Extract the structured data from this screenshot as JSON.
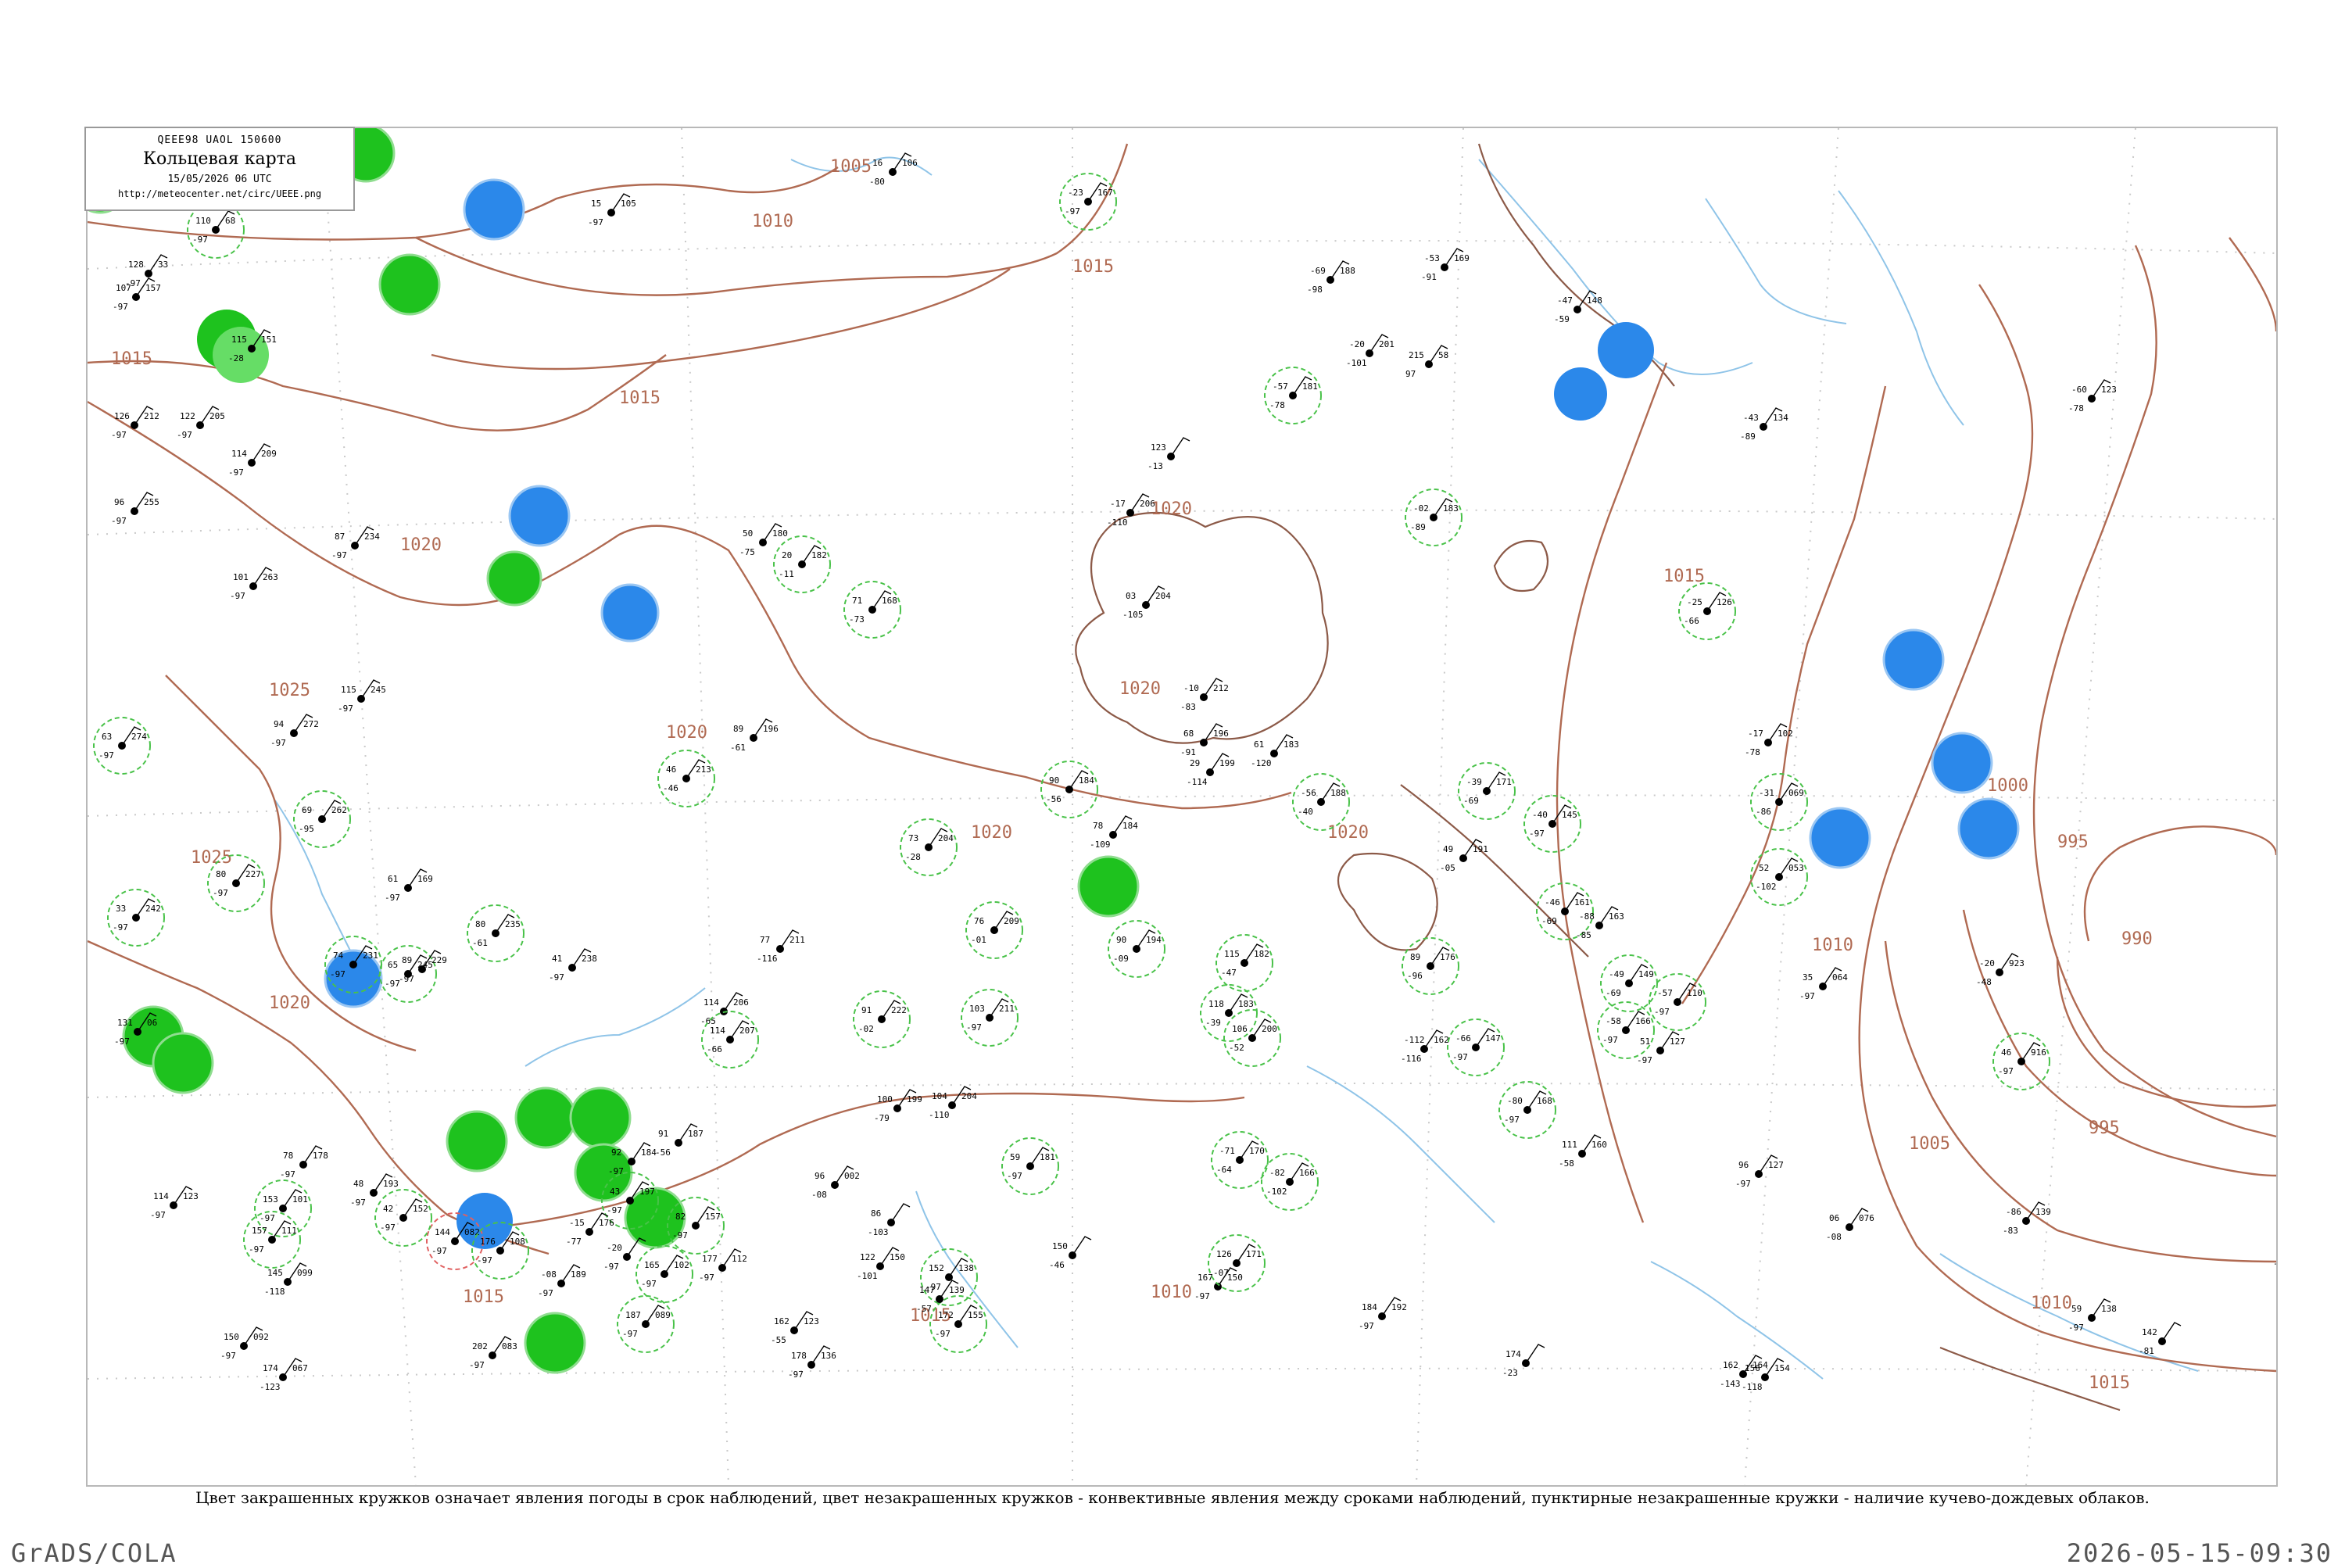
{
  "legend": {
    "header": "QEEE98  UAOL  150600",
    "title": "Кольцевая карта",
    "datetime": "15/05/2026 06 UTC",
    "url": "http://meteocenter.net/circ/UEEE.png"
  },
  "caption": "Цвет закрашенных кружков означает явления погоды в срок наблюдений, цвет незакрашенных кружков - конвективные явления между сроками наблюдений, пунктирные незакрашенные кружки - наличие кучево-дождевых облаков.",
  "footer": {
    "left": "GrADS/COLA",
    "right": "2026-05-15-09:30"
  },
  "isobar_labels": [
    "1005",
    "1010",
    "1015",
    "1015",
    "1015",
    "1020",
    "1020",
    "1020",
    "1020",
    "1020",
    "1020",
    "1025",
    "1025",
    "1020",
    "1015",
    "1015",
    "1010",
    "1005",
    "1000",
    "995",
    "990",
    "995",
    "1010",
    "1015",
    "1010",
    "1015"
  ],
  "colors": {
    "isobar": "#b06a52",
    "coastline": "#8c5a48",
    "river": "#8fc4e8",
    "precip_fill": "#1ec21e",
    "precip_fill_light": "#66dd66",
    "fog_fill": "#2b88ea",
    "cb_ring": "#49c249",
    "thunder_ring": "#e06060"
  },
  "stations": [
    {
      "t": "110",
      "d": "-97",
      "p": "68",
      "marker": "cb"
    },
    {
      "t": "128",
      "d": "-97",
      "p": "33",
      "marker": "none"
    },
    {
      "t": "107",
      "d": "-97",
      "p": "157",
      "marker": "none"
    },
    {
      "t": "115",
      "d": "-28",
      "p": "151",
      "marker": "none"
    },
    {
      "t": "126",
      "d": "-97",
      "p": "212",
      "marker": "none"
    },
    {
      "t": "122",
      "d": "-97",
      "p": "205",
      "marker": "none"
    },
    {
      "t": "114",
      "d": "-97",
      "p": "209",
      "marker": "none"
    },
    {
      "t": "96",
      "d": "-97",
      "p": "255",
      "marker": "none"
    },
    {
      "t": "87",
      "d": "-97",
      "p": "234",
      "marker": "none"
    },
    {
      "t": "101",
      "d": "-97",
      "p": "263",
      "marker": "none"
    },
    {
      "t": "63",
      "d": "-97",
      "p": "274",
      "marker": "cb"
    },
    {
      "t": "115",
      "d": "-97",
      "p": "245",
      "marker": "none"
    },
    {
      "t": "94",
      "d": "-97",
      "p": "272",
      "marker": "none"
    },
    {
      "t": "80",
      "d": "-97",
      "p": "227",
      "marker": "cb"
    },
    {
      "t": "33",
      "d": "-97",
      "p": "242",
      "marker": "cb"
    },
    {
      "t": "131",
      "d": "-97",
      "p": "06",
      "marker": "none"
    },
    {
      "t": "114",
      "d": "-97",
      "p": "123",
      "marker": "none"
    },
    {
      "t": "153",
      "d": "-97",
      "p": "101",
      "marker": "cb"
    },
    {
      "t": "157",
      "d": "-97",
      "p": "111",
      "marker": "cb"
    },
    {
      "t": "145",
      "d": "-118",
      "p": "099",
      "marker": "none"
    },
    {
      "t": "150",
      "d": "-97",
      "p": "092",
      "marker": "none"
    },
    {
      "t": "174",
      "d": "-123",
      "p": "067",
      "marker": "none"
    },
    {
      "t": "144",
      "d": "-97",
      "p": "082",
      "marker": "thunder"
    },
    {
      "t": "202",
      "d": "-97",
      "p": "083",
      "marker": "none"
    },
    {
      "t": "187",
      "d": "-97",
      "p": "089",
      "marker": "cb"
    },
    {
      "t": "165",
      "d": "-97",
      "p": "102",
      "marker": "cb"
    },
    {
      "t": "177",
      "d": "-97",
      "p": "112",
      "marker": "none"
    },
    {
      "t": "162",
      "d": "-55",
      "p": "123",
      "marker": "none"
    },
    {
      "t": "178",
      "d": "-97",
      "p": "136",
      "marker": "none"
    },
    {
      "t": "152",
      "d": "-97",
      "p": "138",
      "marker": "cb"
    },
    {
      "t": "172",
      "d": "-97",
      "p": "155",
      "marker": "cb"
    },
    {
      "t": "167",
      "d": "-97",
      "p": "150",
      "marker": "none"
    },
    {
      "t": "184",
      "d": "-97",
      "p": "192",
      "marker": "none"
    },
    {
      "t": "174",
      "d": "-23",
      "p": "",
      "marker": "none"
    },
    {
      "t": "162",
      "d": "-143",
      "p": "164",
      "marker": "none"
    },
    {
      "t": "156",
      "d": "-118",
      "p": "154",
      "marker": "none"
    },
    {
      "t": "59",
      "d": "-97",
      "p": "138",
      "marker": "none"
    },
    {
      "t": "15",
      "d": "-97",
      "p": "105",
      "marker": "none"
    },
    {
      "t": "16",
      "d": "-80",
      "p": "106",
      "marker": "none"
    },
    {
      "t": "-23",
      "d": "-97",
      "p": "167",
      "marker": "cb"
    },
    {
      "t": "-69",
      "d": "-98",
      "p": "188",
      "marker": "none"
    },
    {
      "t": "-53",
      "d": "-91",
      "p": "169",
      "marker": "none"
    },
    {
      "t": "-47",
      "d": "-59",
      "p": "148",
      "marker": "none"
    },
    {
      "t": "-60",
      "d": "-78",
      "p": "123",
      "marker": "none"
    },
    {
      "t": "-43",
      "d": "-89",
      "p": "134",
      "marker": "none"
    },
    {
      "t": "-02",
      "d": "-89",
      "p": "183",
      "marker": "cb"
    },
    {
      "t": "-25",
      "d": "-66",
      "p": "126",
      "marker": "cb"
    },
    {
      "t": "-17",
      "d": "-78",
      "p": "102",
      "marker": "none"
    },
    {
      "t": "-31",
      "d": "-86",
      "p": "069",
      "marker": "cb"
    },
    {
      "t": "52",
      "d": "-102",
      "p": "053",
      "marker": "cb"
    },
    {
      "t": "35",
      "d": "-97",
      "p": "064",
      "marker": "none"
    },
    {
      "t": "-20",
      "d": "-48",
      "p": "923",
      "marker": "none"
    },
    {
      "t": "46",
      "d": "-97",
      "p": "916",
      "marker": "cb"
    },
    {
      "t": "06",
      "d": "-08",
      "p": "076",
      "marker": "none"
    },
    {
      "t": "-86",
      "d": "-83",
      "p": "139",
      "marker": "none"
    },
    {
      "t": "142",
      "d": "-81",
      "p": "",
      "marker": "none"
    },
    {
      "t": "106",
      "d": "-97",
      "p": "152",
      "marker": "none"
    },
    {
      "t": "51",
      "d": "-97",
      "p": "127",
      "marker": "none"
    },
    {
      "t": "96",
      "d": "-97",
      "p": "127",
      "marker": "none"
    },
    {
      "t": "111",
      "d": "-58",
      "p": "160",
      "marker": "none"
    },
    {
      "t": "89",
      "d": "-96",
      "p": "176",
      "marker": "cb"
    },
    {
      "t": "49",
      "d": "-05",
      "p": "191",
      "marker": "none"
    },
    {
      "t": "-56",
      "d": "-40",
      "p": "188",
      "marker": "cb"
    },
    {
      "t": "-39",
      "d": "-69",
      "p": "171",
      "marker": "cb"
    },
    {
      "t": "-40",
      "d": "-97",
      "p": "145",
      "marker": "cb"
    },
    {
      "t": "-46",
      "d": "-69",
      "p": "161",
      "marker": "cb"
    },
    {
      "t": "-88",
      "d": "-85",
      "p": "163",
      "marker": "none"
    },
    {
      "t": "-49",
      "d": "-69",
      "p": "149",
      "marker": "cb"
    },
    {
      "t": "-57",
      "d": "-97",
      "p": "110",
      "marker": "cb"
    },
    {
      "t": "-58",
      "d": "-97",
      "p": "166",
      "marker": "cb"
    },
    {
      "t": "-66",
      "d": "-97",
      "p": "147",
      "marker": "cb"
    },
    {
      "t": "-80",
      "d": "-97",
      "p": "168",
      "marker": "cb"
    },
    {
      "t": "-112",
      "d": "-116",
      "p": "162",
      "marker": "none"
    },
    {
      "t": "-71",
      "d": "-64",
      "p": "170",
      "marker": "cb"
    },
    {
      "t": "-82",
      "d": "-102",
      "p": "166",
      "marker": "cb"
    },
    {
      "t": "-57",
      "d": "-78",
      "p": "181",
      "marker": "cb"
    },
    {
      "t": "-20",
      "d": "-101",
      "p": "201",
      "marker": "none"
    },
    {
      "t": "215",
      "d": "97",
      "p": "58",
      "marker": "none"
    },
    {
      "t": "123",
      "d": "-13",
      "p": "",
      "marker": "none"
    },
    {
      "t": "-17",
      "d": "-110",
      "p": "206",
      "marker": "none"
    },
    {
      "t": "03",
      "d": "-105",
      "p": "204",
      "marker": "none"
    },
    {
      "t": "-10",
      "d": "-83",
      "p": "212",
      "marker": "none"
    },
    {
      "t": "68",
      "d": "-91",
      "p": "196",
      "marker": "none"
    },
    {
      "t": "29",
      "d": "-114",
      "p": "199",
      "marker": "none"
    },
    {
      "t": "61",
      "d": "-120",
      "p": "183",
      "marker": "none"
    },
    {
      "t": "78",
      "d": "-109",
      "p": "184",
      "marker": "none"
    },
    {
      "t": "90",
      "d": "-56",
      "p": "184",
      "marker": "cb"
    },
    {
      "t": "73",
      "d": "-28",
      "p": "204",
      "marker": "cb"
    },
    {
      "t": "77",
      "d": "-116",
      "p": "211",
      "marker": "none"
    },
    {
      "t": "71",
      "d": "-73",
      "p": "168",
      "marker": "cb"
    },
    {
      "t": "50",
      "d": "-75",
      "p": "180",
      "marker": "none"
    },
    {
      "t": "20",
      "d": "-11",
      "p": "182",
      "marker": "cb"
    },
    {
      "t": "89",
      "d": "-61",
      "p": "196",
      "marker": "none"
    },
    {
      "t": "46",
      "d": "-46",
      "p": "213",
      "marker": "cb"
    },
    {
      "t": "76",
      "d": "-01",
      "p": "209",
      "marker": "cb"
    },
    {
      "t": "103",
      "d": "-97",
      "p": "211",
      "marker": "cb"
    },
    {
      "t": "91",
      "d": "-02",
      "p": "222",
      "marker": "cb"
    },
    {
      "t": "114",
      "d": "-65",
      "p": "206",
      "marker": "none"
    },
    {
      "t": "114",
      "d": "-66",
      "p": "207",
      "marker": "cb"
    },
    {
      "t": "90",
      "d": "-09",
      "p": "194",
      "marker": "cb"
    },
    {
      "t": "115",
      "d": "-47",
      "p": "182",
      "marker": "cb"
    },
    {
      "t": "118",
      "d": "-39",
      "p": "183",
      "marker": "cb"
    },
    {
      "t": "106",
      "d": "-52",
      "p": "200",
      "marker": "cb"
    },
    {
      "t": "100",
      "d": "-79",
      "p": "199",
      "marker": "none"
    },
    {
      "t": "104",
      "d": "-110",
      "p": "204",
      "marker": "none"
    },
    {
      "t": "86",
      "d": "-103",
      "p": "",
      "marker": "none"
    },
    {
      "t": "96",
      "d": "-08",
      "p": "002",
      "marker": "none"
    },
    {
      "t": "122",
      "d": "-101",
      "p": "150",
      "marker": "none"
    },
    {
      "t": "147",
      "d": "-57",
      "p": "139",
      "marker": "none"
    },
    {
      "t": "150",
      "d": "-46",
      "p": "",
      "marker": "none"
    },
    {
      "t": "126",
      "d": "-07",
      "p": "171",
      "marker": "cb"
    },
    {
      "t": "59",
      "d": "-97",
      "p": "181",
      "marker": "cb"
    },
    {
      "t": "91",
      "d": "-56",
      "p": "187",
      "marker": "none"
    },
    {
      "t": "92",
      "d": "-97",
      "p": "184",
      "marker": "none"
    },
    {
      "t": "43",
      "d": "-97",
      "p": "197",
      "marker": "cb"
    },
    {
      "t": "82",
      "d": "-97",
      "p": "157",
      "marker": "cb"
    },
    {
      "t": "-15",
      "d": "-77",
      "p": "176",
      "marker": "none"
    },
    {
      "t": "41",
      "d": "-97",
      "p": "238",
      "marker": "none"
    },
    {
      "t": "69",
      "d": "-95",
      "p": "262",
      "marker": "cb"
    },
    {
      "t": "80",
      "d": "-61",
      "p": "235",
      "marker": "cb"
    },
    {
      "t": "74",
      "d": "-97",
      "p": "231",
      "marker": "cb"
    },
    {
      "t": "65",
      "d": "-97",
      "p": "245",
      "marker": "cb"
    },
    {
      "t": "89",
      "d": "-97",
      "p": "229",
      "marker": "none"
    },
    {
      "t": "61",
      "d": "-97",
      "p": "169",
      "marker": "none"
    },
    {
      "t": "78",
      "d": "-97",
      "p": "178",
      "marker": "none"
    },
    {
      "t": "48",
      "d": "-97",
      "p": "193",
      "marker": "none"
    },
    {
      "t": "42",
      "d": "-97",
      "p": "152",
      "marker": "cb"
    },
    {
      "t": "176",
      "d": "-97",
      "p": "108",
      "marker": "cb"
    },
    {
      "t": "-08",
      "d": "-97",
      "p": "189",
      "marker": "none"
    },
    {
      "t": "-20",
      "d": "-97",
      "p": "",
      "marker": "none"
    }
  ]
}
